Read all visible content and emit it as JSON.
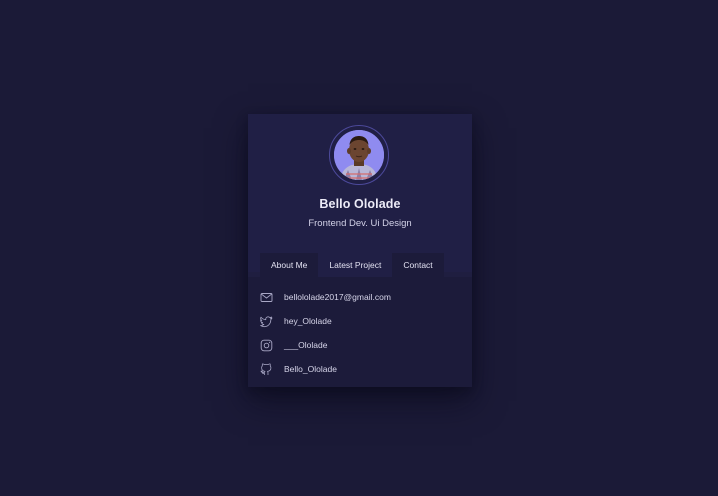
{
  "profile": {
    "name": "Bello Ololade",
    "role": "Frontend Dev. Ui Design",
    "avatar_icon": "profile-photo"
  },
  "tabs": [
    {
      "label": "About Me"
    },
    {
      "label": "Latest Project"
    },
    {
      "label": "Contact"
    }
  ],
  "contacts": [
    {
      "icon": "mail-icon",
      "text": "bellololade2017@gmail.com"
    },
    {
      "icon": "twitter-icon",
      "text": "hey_Ololade"
    },
    {
      "icon": "instagram-icon",
      "text": "___Ololade"
    },
    {
      "icon": "github-icon",
      "text": "Bello_Ololade"
    }
  ],
  "colors": {
    "background": "#1b1a37",
    "card": "#1f1e40",
    "accent": "#8f8bf0",
    "text": "#ecebf7"
  }
}
